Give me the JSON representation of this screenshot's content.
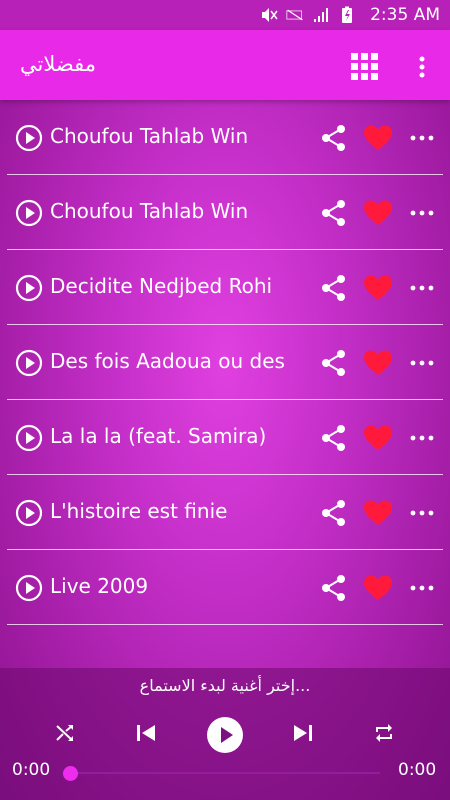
{
  "status": {
    "time": "2:35 AM"
  },
  "app_bar": {
    "title": "مفضلاتي"
  },
  "songs": [
    {
      "title": "Choufou Tahlab Win"
    },
    {
      "title": "Choufou Tahlab Win"
    },
    {
      "title": "Decidite Nedjbed Rohi"
    },
    {
      "title": "Des fois Aadoua ou des"
    },
    {
      "title": "La la la (feat. Samira)"
    },
    {
      "title": "L'histoire est finie"
    },
    {
      "title": "Live 2009"
    }
  ],
  "player": {
    "hint": "إختر أغنية لبدء الاستماع...",
    "elapsed": "0:00",
    "duration": "0:00",
    "progress": 0
  },
  "colors": {
    "heart": "#ff1a3c",
    "accent": "#e82ae8"
  }
}
